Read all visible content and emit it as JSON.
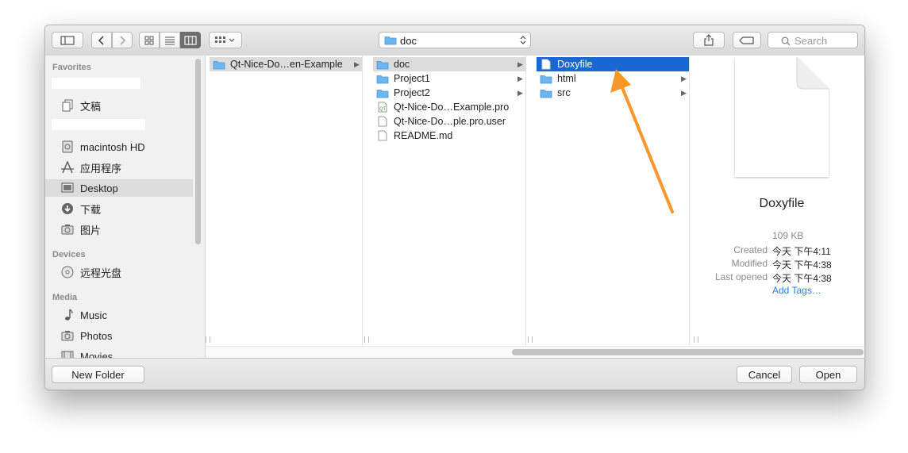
{
  "toolbar": {
    "path_label": "doc",
    "search_placeholder": "Search"
  },
  "sidebar": {
    "sections": {
      "favorites": "Favorites",
      "devices": "Devices",
      "media": "Media"
    },
    "favorites": [
      {
        "label": "文稿",
        "icon": "documents-icon"
      },
      {
        "label": "macintosh HD",
        "icon": "hard-disk-icon"
      },
      {
        "label": "应用程序",
        "icon": "applications-icon"
      },
      {
        "label": "Desktop",
        "icon": "desktop-icon",
        "selected": true
      },
      {
        "label": "下载",
        "icon": "downloads-icon"
      },
      {
        "label": "图片",
        "icon": "pictures-icon"
      }
    ],
    "devices": [
      {
        "label": "远程光盘",
        "icon": "optical-disc-icon"
      }
    ],
    "media": [
      {
        "label": "Music",
        "icon": "music-icon"
      },
      {
        "label": "Photos",
        "icon": "camera-icon"
      },
      {
        "label": "Movies",
        "icon": "film-icon"
      }
    ]
  },
  "columns": [
    {
      "items": [
        {
          "label": "Qt-Nice-Do…en-Example",
          "type": "folder",
          "selected": "gray"
        }
      ]
    },
    {
      "items": [
        {
          "label": "doc",
          "type": "folder",
          "selected": "gray"
        },
        {
          "label": "Project1",
          "type": "folder"
        },
        {
          "label": "Project2",
          "type": "folder"
        },
        {
          "label": "Qt-Nice-Do…Example.pro",
          "type": "qt-file"
        },
        {
          "label": "Qt-Nice-Do…ple.pro.user",
          "type": "file"
        },
        {
          "label": "README.md",
          "type": "file"
        }
      ]
    },
    {
      "items": [
        {
          "label": "Doxyfile",
          "type": "file",
          "selected": "blue"
        },
        {
          "label": "html",
          "type": "folder"
        },
        {
          "label": "src",
          "type": "folder"
        }
      ]
    }
  ],
  "preview": {
    "name": "Doxyfile",
    "size": "109 KB",
    "created_label": "Created",
    "created_value": "今天 下午4:11",
    "modified_label": "Modified",
    "modified_value": "今天 下午4:38",
    "last_opened_label": "Last opened",
    "last_opened_value": "今天 下午4:38",
    "add_tags": "Add Tags…"
  },
  "buttons": {
    "new_folder": "New Folder",
    "cancel": "Cancel",
    "open": "Open"
  },
  "colors": {
    "selection_blue": "#1a66d2",
    "folder_blue": "#6cb5ef",
    "annotation_arrow": "#f7962b",
    "link_blue": "#2a7de1"
  }
}
